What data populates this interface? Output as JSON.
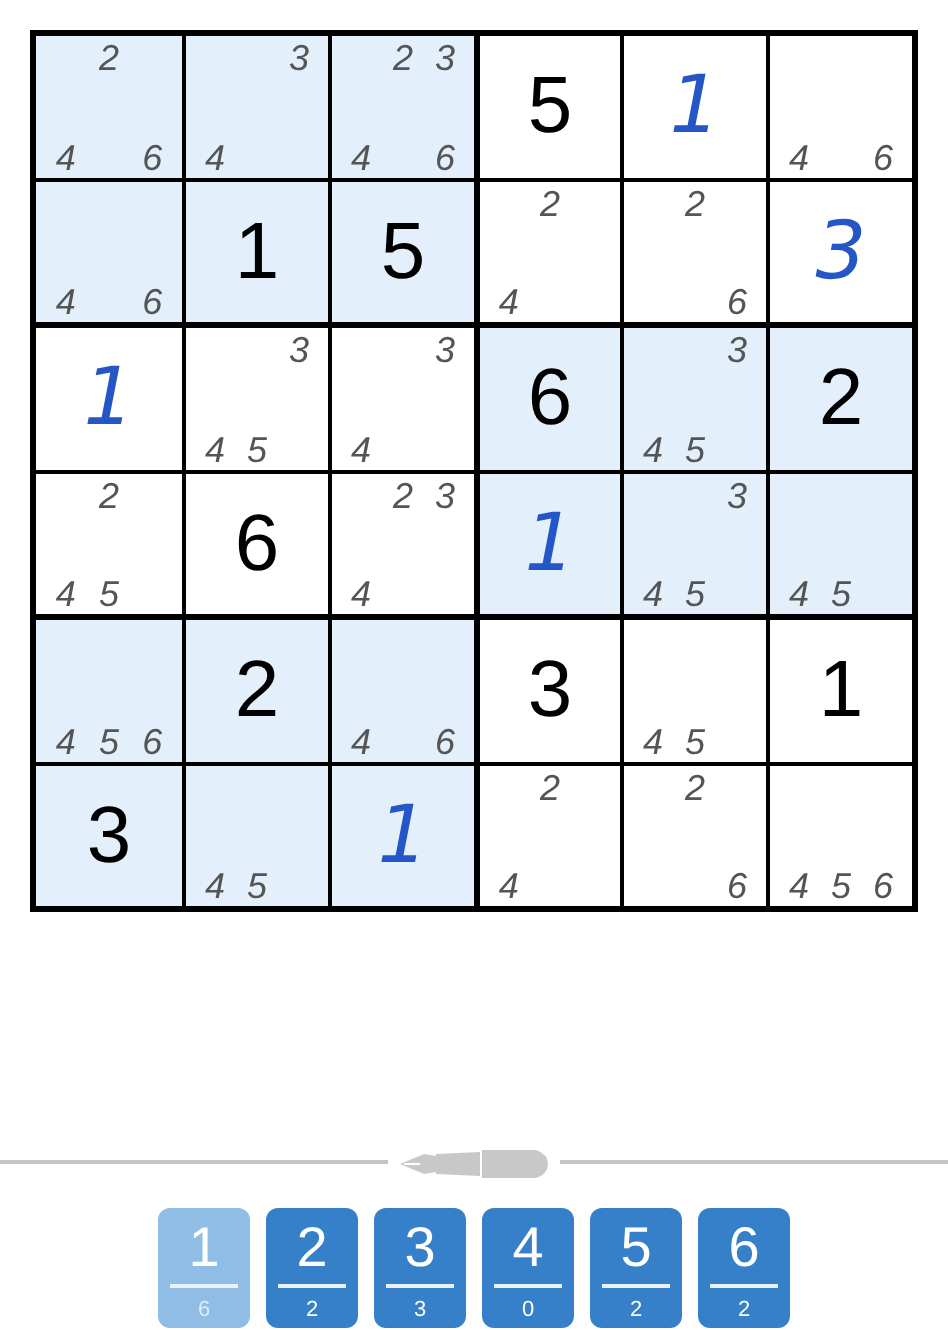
{
  "grid": [
    [
      {
        "highlighted": true,
        "notes": [
          {
            "text": "2",
            "kind": "top"
          },
          {
            "text": "4",
            "kind": "bottomleft"
          },
          {
            "text": "6",
            "kind": "bottomright"
          }
        ]
      },
      {
        "highlighted": true,
        "notes": [
          {
            "text": "3",
            "kind": "topright"
          },
          {
            "text": "4",
            "kind": "bottomleft"
          }
        ]
      },
      {
        "highlighted": true,
        "notes": [
          {
            "text": "2",
            "kind": "top"
          },
          {
            "text": "3",
            "kind": "topright"
          },
          {
            "text": "4",
            "kind": "bottomleft"
          },
          {
            "text": "6",
            "kind": "bottomright"
          }
        ]
      },
      {
        "highlighted": false,
        "value": "5",
        "kind": "given"
      },
      {
        "highlighted": false,
        "value": "1",
        "kind": "entered"
      },
      {
        "highlighted": false,
        "notes": [
          {
            "text": "4",
            "kind": "bottomleft"
          },
          {
            "text": "6",
            "kind": "bottomright"
          }
        ]
      }
    ],
    [
      {
        "highlighted": true,
        "notes": [
          {
            "text": "4",
            "kind": "bottomleft"
          },
          {
            "text": "6",
            "kind": "bottomright"
          }
        ]
      },
      {
        "highlighted": true,
        "value": "1",
        "kind": "given"
      },
      {
        "highlighted": true,
        "value": "5",
        "kind": "given"
      },
      {
        "highlighted": false,
        "notes": [
          {
            "text": "2",
            "kind": "top"
          },
          {
            "text": "4",
            "kind": "bottomleft"
          }
        ]
      },
      {
        "highlighted": false,
        "notes": [
          {
            "text": "2",
            "kind": "top"
          },
          {
            "text": "6",
            "kind": "bottomright"
          }
        ]
      },
      {
        "highlighted": false,
        "value": "3",
        "kind": "entered"
      }
    ],
    [
      {
        "highlighted": false,
        "value": "1",
        "kind": "entered"
      },
      {
        "highlighted": false,
        "notes": [
          {
            "text": "3",
            "kind": "topright"
          },
          {
            "text": "4",
            "kind": "bottomleft"
          },
          {
            "text": "5",
            "kind": "bottom"
          }
        ]
      },
      {
        "highlighted": false,
        "notes": [
          {
            "text": "3",
            "kind": "topright"
          },
          {
            "text": "4",
            "kind": "bottomleft"
          }
        ]
      },
      {
        "highlighted": true,
        "value": "6",
        "kind": "given"
      },
      {
        "highlighted": true,
        "notes": [
          {
            "text": "3",
            "kind": "topright"
          },
          {
            "text": "4",
            "kind": "bottomleft"
          },
          {
            "text": "5",
            "kind": "bottom"
          }
        ]
      },
      {
        "highlighted": true,
        "value": "2",
        "kind": "given"
      }
    ],
    [
      {
        "highlighted": false,
        "notes": [
          {
            "text": "2",
            "kind": "top"
          },
          {
            "text": "4",
            "kind": "bottomleft"
          },
          {
            "text": "5",
            "kind": "bottom"
          }
        ]
      },
      {
        "highlighted": false,
        "value": "6",
        "kind": "given"
      },
      {
        "highlighted": false,
        "notes": [
          {
            "text": "2",
            "kind": "top"
          },
          {
            "text": "3",
            "kind": "topright"
          },
          {
            "text": "4",
            "kind": "bottomleft"
          }
        ]
      },
      {
        "highlighted": true,
        "value": "1",
        "kind": "entered"
      },
      {
        "highlighted": true,
        "notes": [
          {
            "text": "3",
            "kind": "topright"
          },
          {
            "text": "4",
            "kind": "bottomleft"
          },
          {
            "text": "5",
            "kind": "bottom"
          }
        ]
      },
      {
        "highlighted": true,
        "notes": [
          {
            "text": "4",
            "kind": "bottomleft"
          },
          {
            "text": "5",
            "kind": "bottom"
          }
        ]
      }
    ],
    [
      {
        "highlighted": true,
        "notes": [
          {
            "text": "4",
            "kind": "bottomleft"
          },
          {
            "text": "5",
            "kind": "bottom"
          },
          {
            "text": "6",
            "kind": "bottomright"
          }
        ]
      },
      {
        "highlighted": true,
        "value": "2",
        "kind": "given"
      },
      {
        "highlighted": true,
        "notes": [
          {
            "text": "4",
            "kind": "bottomleft"
          },
          {
            "text": "6",
            "kind": "bottomright"
          }
        ]
      },
      {
        "highlighted": false,
        "value": "3",
        "kind": "given"
      },
      {
        "highlighted": false,
        "notes": [
          {
            "text": "4",
            "kind": "bottomleft"
          },
          {
            "text": "5",
            "kind": "bottom"
          }
        ]
      },
      {
        "highlighted": false,
        "value": "1",
        "kind": "given"
      }
    ],
    [
      {
        "highlighted": true,
        "value": "3",
        "kind": "given"
      },
      {
        "highlighted": true,
        "notes": [
          {
            "text": "4",
            "kind": "bottomleft"
          },
          {
            "text": "5",
            "kind": "bottom"
          }
        ]
      },
      {
        "highlighted": true,
        "value": "1",
        "kind": "entered"
      },
      {
        "highlighted": false,
        "notes": [
          {
            "text": "2",
            "kind": "top"
          },
          {
            "text": "4",
            "kind": "bottomleft"
          }
        ]
      },
      {
        "highlighted": false,
        "notes": [
          {
            "text": "2",
            "kind": "top"
          },
          {
            "text": "6",
            "kind": "bottomright"
          }
        ]
      },
      {
        "highlighted": false,
        "notes": [
          {
            "text": "4",
            "kind": "bottomleft"
          },
          {
            "text": "5",
            "kind": "bottom"
          },
          {
            "text": "6",
            "kind": "bottomright"
          }
        ]
      }
    ]
  ],
  "number_pad": [
    {
      "digit": "1",
      "count": "6",
      "completed": true
    },
    {
      "digit": "2",
      "count": "2",
      "completed": false
    },
    {
      "digit": "3",
      "count": "3",
      "completed": false
    },
    {
      "digit": "4",
      "count": "0",
      "completed": false
    },
    {
      "digit": "5",
      "count": "2",
      "completed": false
    },
    {
      "digit": "6",
      "count": "2",
      "completed": false
    }
  ]
}
